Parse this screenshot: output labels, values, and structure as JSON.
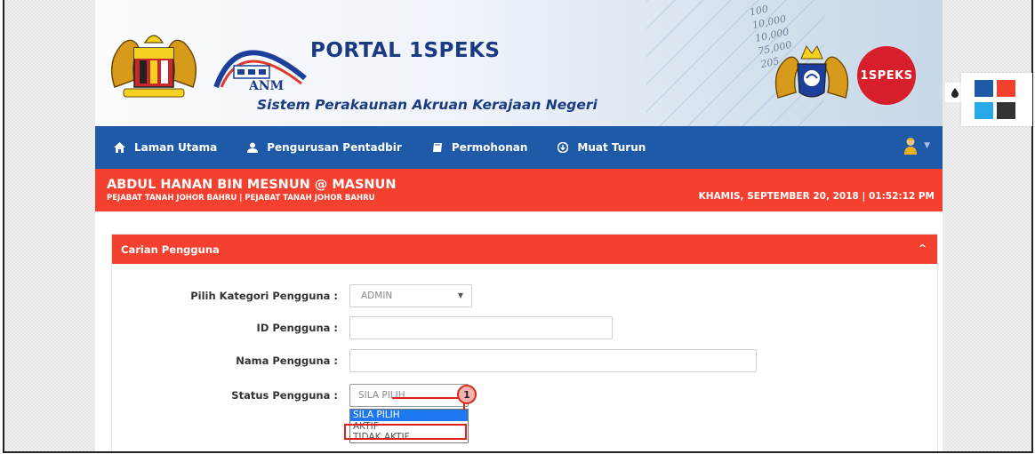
{
  "header": {
    "portal_title": "PORTAL 1SPEKS",
    "subtitle": "Sistem Perakaunan Akruan Kerajaan Negeri",
    "anm_label": "ANM",
    "badge_label": "1SPEKS",
    "deco_numbers": [
      "100",
      "10,000",
      "10,000",
      "75,000",
      "205"
    ]
  },
  "nav": {
    "items": [
      {
        "label": "Laman Utama",
        "icon": "home-icon"
      },
      {
        "label": "Pengurusan Pentadbir",
        "icon": "user-icon"
      },
      {
        "label": "Permohonan",
        "icon": "book-icon"
      },
      {
        "label": "Muat Turun",
        "icon": "download-icon"
      }
    ],
    "user_icon": "user-avatar-icon"
  },
  "user": {
    "name": "ABDUL HANAN BIN MESNUN @ MASNUN",
    "office": "PEJABAT TANAH JOHOR BAHRU | PEJABAT TANAH JOHOR BAHRU",
    "datetime": "KHAMIS, SEPTEMBER 20, 2018 | 01:52:12 PM"
  },
  "panel": {
    "title": "Carian Pengguna",
    "collapse_icon": "chevron-up-icon"
  },
  "form": {
    "kategori_label": "Pilih Kategori Pengguna :",
    "kategori_value": "ADMIN",
    "id_label": "ID Pengguna :",
    "id_value": "",
    "nama_label": "Nama Pengguna :",
    "nama_value": "",
    "status_label": "Status Pengguna :",
    "status_value": "SILA PILIH",
    "status_options": [
      "SILA PILIH",
      "AKTIF",
      "TIDAK AKTIF"
    ]
  },
  "callout": {
    "number": "1"
  },
  "palette": {
    "icon": "droplet-icon",
    "colors": [
      "#1e5aa8",
      "#f4402f",
      "#29a8e8",
      "#333333"
    ]
  }
}
